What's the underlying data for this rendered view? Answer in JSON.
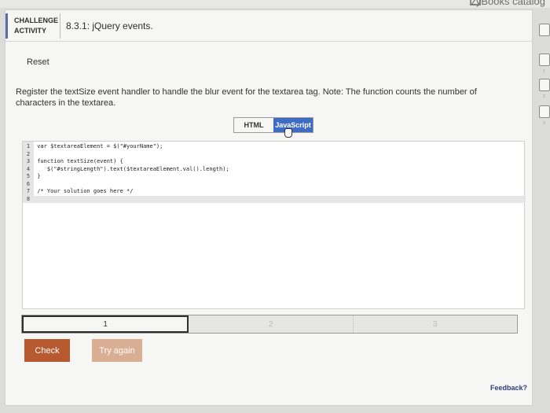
{
  "catalog": {
    "label": "zyBooks catalog"
  },
  "header": {
    "challenge_line1": "CHALLENGE",
    "challenge_line2": "ACTIVITY",
    "title": "8.3.1: jQuery events."
  },
  "reset_label": "Reset",
  "instructions": "Register the textSize event handler to handle the blur event for the textarea tag. Note: The function counts the number of characters in the textarea.",
  "tabs": [
    {
      "label": "HTML",
      "selected": false
    },
    {
      "label": "JavaScript",
      "selected": true
    }
  ],
  "editor": {
    "lines": [
      {
        "num": "1",
        "code": "var $textareaElement = $(\"#yourName\");"
      },
      {
        "num": "2",
        "code": ""
      },
      {
        "num": "3",
        "code": "function textSize(event) {"
      },
      {
        "num": "4",
        "code": "   $(\"#stringLength\").text($textareaElement.val().length);"
      },
      {
        "num": "5",
        "code": "}"
      },
      {
        "num": "6",
        "code": ""
      },
      {
        "num": "7",
        "code": "/* Your solution goes here */"
      },
      {
        "num": "8",
        "code": ""
      }
    ]
  },
  "progress": {
    "steps": [
      "1",
      "2",
      "3"
    ],
    "current": 1
  },
  "buttons": {
    "check": "Check",
    "try_again": "Try again"
  },
  "feedback_label": "Feedback?",
  "side_numbers": [
    "1",
    "2",
    "3"
  ],
  "colors": {
    "accent": "#3e6cc2",
    "check": "#b85a30",
    "try_again": "#d9ae92"
  }
}
